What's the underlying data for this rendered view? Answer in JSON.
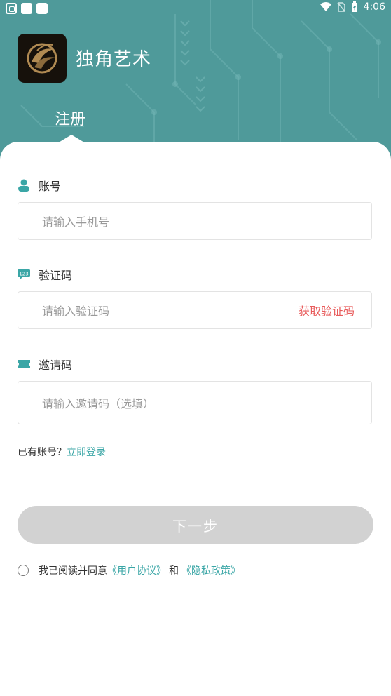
{
  "status_bar": {
    "time": "4:06"
  },
  "app": {
    "name": "独角艺术"
  },
  "tab": {
    "label": "注册"
  },
  "form": {
    "account": {
      "label": "账号",
      "placeholder": "请输入手机号",
      "value": ""
    },
    "code": {
      "label": "验证码",
      "placeholder": "请输入验证码",
      "value": "",
      "get_code_label": "获取验证码"
    },
    "invite": {
      "label": "邀请码",
      "placeholder": "请输入邀请码（选填）",
      "value": ""
    }
  },
  "login": {
    "prompt": "已有账号？",
    "link": "立即登录"
  },
  "next_button": {
    "label": "下一步"
  },
  "agreement": {
    "prefix": "我已阅读并同意",
    "user_agreement": "《用户协议》",
    "and": "和",
    "privacy_policy": "《隐私政策》"
  },
  "colors": {
    "header_bg": "#4f9a9a",
    "accent": "#3aa6a6",
    "get_code": "#e85a5a",
    "button_disabled": "#d2d2d2"
  },
  "icons": {
    "account": "person-icon",
    "code": "code-123-icon",
    "invite": "ticket-icon"
  }
}
